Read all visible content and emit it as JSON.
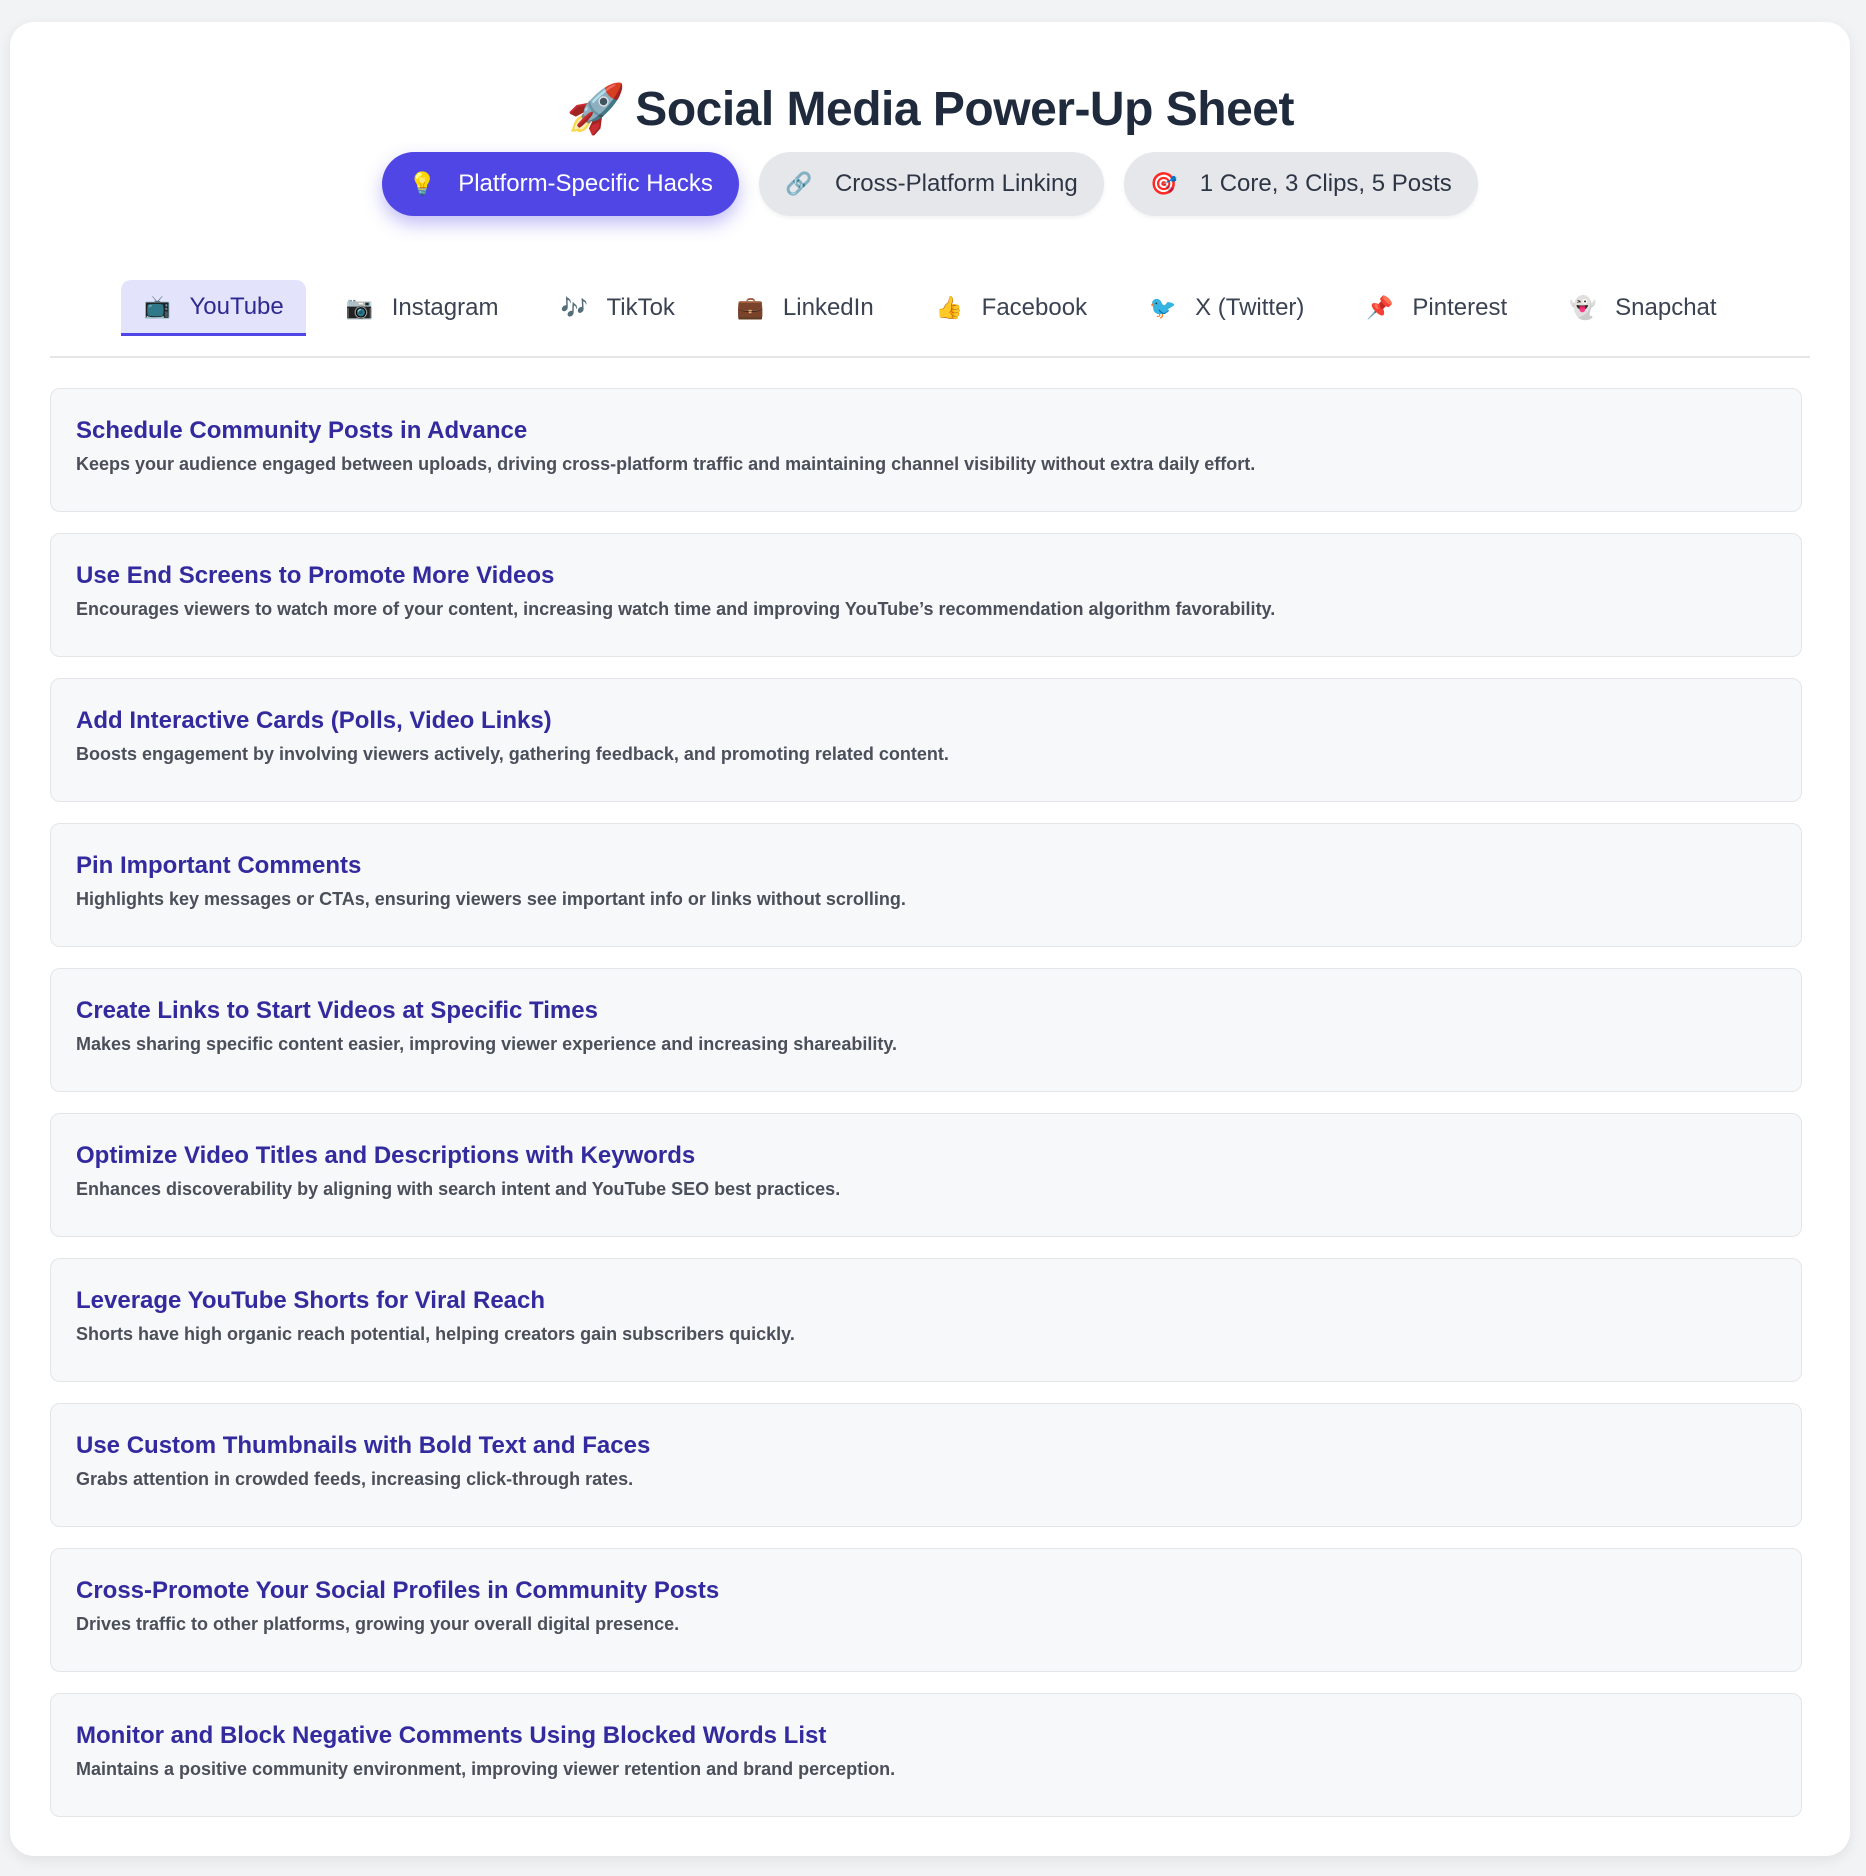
{
  "header": {
    "title_icon": "rocket-icon",
    "title_icon_glyph": "🚀",
    "title": "Social Media Power-Up Sheet"
  },
  "modes": [
    {
      "icon": "lightbulb-icon",
      "glyph": "💡",
      "label": "Platform-Specific Hacks",
      "active": true
    },
    {
      "icon": "link-icon",
      "glyph": "🔗",
      "label": "Cross-Platform Linking",
      "active": false
    },
    {
      "icon": "target-icon",
      "glyph": "🎯",
      "label": "1 Core, 3 Clips, 5 Posts",
      "active": false
    }
  ],
  "platform_tabs": [
    {
      "icon": "tv-icon",
      "glyph": "📺",
      "label": "YouTube",
      "active": true
    },
    {
      "icon": "camera-icon",
      "glyph": "📷",
      "label": "Instagram",
      "active": false
    },
    {
      "icon": "music-notes-icon",
      "glyph": "🎶",
      "label": "TikTok",
      "active": false
    },
    {
      "icon": "briefcase-icon",
      "glyph": "💼",
      "label": "LinkedIn",
      "active": false
    },
    {
      "icon": "thumbs-up-icon",
      "glyph": "👍",
      "label": "Facebook",
      "active": false
    },
    {
      "icon": "bird-icon",
      "glyph": "🐦",
      "label": "X (Twitter)",
      "active": false
    },
    {
      "icon": "pushpin-icon",
      "glyph": "📌",
      "label": "Pinterest",
      "active": false
    },
    {
      "icon": "ghost-icon",
      "glyph": "👻",
      "label": "Snapchat",
      "active": false
    }
  ],
  "hacks": [
    {
      "title": "Schedule Community Posts in Advance",
      "description": "Keeps your audience engaged between uploads, driving cross-platform traffic and maintaining channel visibility without extra daily effort."
    },
    {
      "title": "Use End Screens to Promote More Videos",
      "description": "Encourages viewers to watch more of your content, increasing watch time and improving YouTube’s recommendation algorithm favorability."
    },
    {
      "title": "Add Interactive Cards (Polls, Video Links)",
      "description": "Boosts engagement by involving viewers actively, gathering feedback, and promoting related content."
    },
    {
      "title": "Pin Important Comments",
      "description": "Highlights key messages or CTAs, ensuring viewers see important info or links without scrolling."
    },
    {
      "title": "Create Links to Start Videos at Specific Times",
      "description": "Makes sharing specific content easier, improving viewer experience and increasing shareability."
    },
    {
      "title": "Optimize Video Titles and Descriptions with Keywords",
      "description": "Enhances discoverability by aligning with search intent and YouTube SEO best practices."
    },
    {
      "title": "Leverage YouTube Shorts for Viral Reach",
      "description": "Shorts have high organic reach potential, helping creators gain subscribers quickly."
    },
    {
      "title": "Use Custom Thumbnails with Bold Text and Faces",
      "description": "Grabs attention in crowded feeds, increasing click-through rates."
    },
    {
      "title": "Cross-Promote Your Social Profiles in Community Posts",
      "description": "Drives traffic to other platforms, growing your overall digital presence."
    },
    {
      "title": "Monitor and Block Negative Comments Using Blocked Words List",
      "description": "Maintains a positive community environment, improving viewer retention and brand perception."
    }
  ],
  "colors": {
    "accent": "#4f46e5",
    "heading": "#1f2a3d",
    "hack_title": "#332a9e",
    "active_tab_bg": "#e3e4fb"
  }
}
